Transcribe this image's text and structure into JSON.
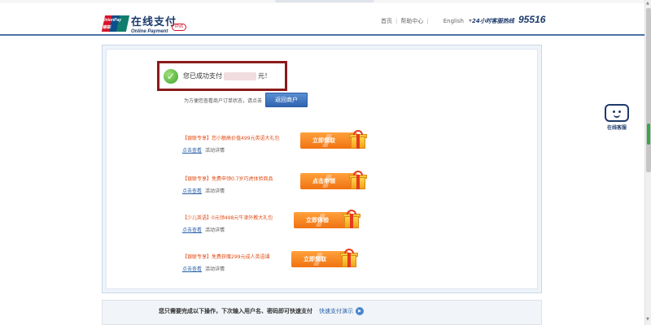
{
  "header": {
    "logo_mark_line1": "UnionPay",
    "logo_mark_line2": "银联",
    "logo_cn": "在线支付",
    "logo_en": "Online Payment",
    "ipv6": "IPv6",
    "links": [
      "首页",
      "帮助中心"
    ],
    "language": "English",
    "hotline_label": "24小时客服热线",
    "hotline_number": "95516"
  },
  "success": {
    "prefix": "您已成功支付",
    "suffix": "元！"
  },
  "hint": {
    "text": "为方便您查看商户订单状态，请点击",
    "return_button": "返回商户"
  },
  "promos": [
    {
      "title": "【银联专享】您小额高价值499元英语大礼包",
      "detail_link": "点击查看",
      "detail_text": "活动详情",
      "button": "立即领取"
    },
    {
      "title": "【银联专享】免费申领0.7岁巧虎体验商品",
      "detail_link": "点击查看",
      "detail_text": "活动详情",
      "button": "点击申领"
    },
    {
      "title": "【少儿英语】0元领498元牛津外教大礼包",
      "detail_link": "点击查看",
      "detail_text": "活动详情",
      "button": "立即体验"
    },
    {
      "title": "【银联专享】免费获赠299元成人英语课",
      "detail_link": "点击查看",
      "detail_text": "活动详情",
      "button": "立即领取"
    }
  ],
  "bottom": {
    "text": "您只需要完成以下操作，下次输入用户名、密码即可快速支付",
    "link": "快速支付演示"
  },
  "service": {
    "label": "在线客服"
  },
  "colors": {
    "brand_blue": "#1c3a6b",
    "promo_orange": "#f07212",
    "success_border": "#8b1a1a",
    "link_blue": "#2a62a8"
  }
}
